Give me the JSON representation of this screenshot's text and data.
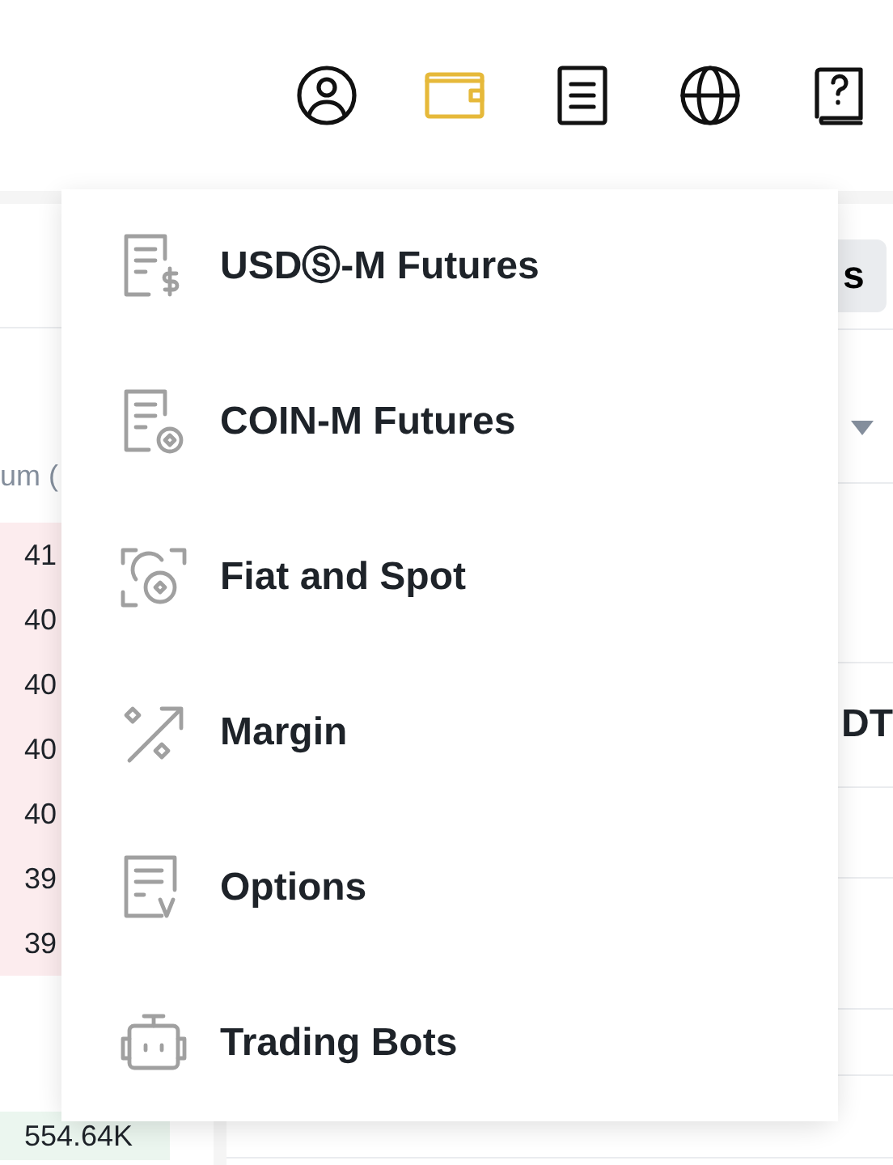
{
  "header": {
    "icons": [
      {
        "kind": "account",
        "selected": false
      },
      {
        "kind": "wallet",
        "selected": true
      },
      {
        "kind": "orders",
        "selected": false
      },
      {
        "kind": "language",
        "selected": false
      },
      {
        "kind": "help",
        "selected": false
      }
    ]
  },
  "order_book": {
    "column_header": "um (",
    "rows": [
      {
        "text": "41",
        "kind": "sell"
      },
      {
        "text": "40",
        "kind": "sell"
      },
      {
        "text": "40",
        "kind": "sell"
      },
      {
        "text": "40",
        "kind": "sell"
      },
      {
        "text": "40",
        "kind": "sell"
      },
      {
        "text": "39",
        "kind": "sell"
      },
      {
        "text": "39",
        "kind": "sell"
      },
      {
        "text": "554.64K",
        "kind": "buy"
      }
    ]
  },
  "right_panel": {
    "button": "s",
    "pair_text": "DT"
  },
  "wallet_menu": {
    "items": [
      {
        "label": "USDⓈ-M Futures",
        "kind": "usds_futures"
      },
      {
        "label": "COIN-M Futures",
        "kind": "coin_futures"
      },
      {
        "label": "Fiat and Spot",
        "kind": "spot"
      },
      {
        "label": "Margin",
        "kind": "margin"
      },
      {
        "label": "Options",
        "kind": "options"
      },
      {
        "label": "Trading Bots",
        "kind": "bots"
      }
    ]
  }
}
